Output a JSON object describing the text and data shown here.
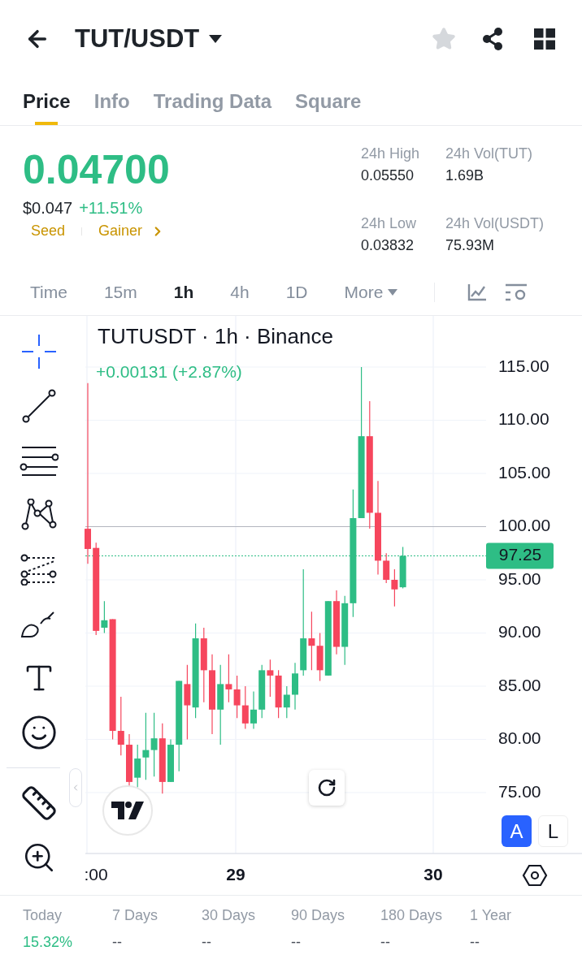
{
  "header": {
    "pair": "TUT/USDT",
    "favorite": false
  },
  "tabs": [
    {
      "label": "Price",
      "selected": true
    },
    {
      "label": "Info",
      "selected": false
    },
    {
      "label": "Trading Data",
      "selected": false
    },
    {
      "label": "Square",
      "selected": false
    }
  ],
  "price": {
    "last": "0.04700",
    "usd": "$0.047",
    "change": "+11.51%",
    "tags": [
      "Seed",
      "Gainer"
    ]
  },
  "stats": [
    {
      "label": "24h High",
      "value": "0.05550"
    },
    {
      "label": "24h Vol(TUT)",
      "value": "1.69B"
    },
    {
      "label": "24h Low",
      "value": "0.03832"
    },
    {
      "label": "24h Vol(USDT)",
      "value": "75.93M"
    }
  ],
  "intervals": [
    {
      "label": "Time",
      "selected": false,
      "kind": "plain"
    },
    {
      "label": "15m",
      "selected": false,
      "kind": "plain"
    },
    {
      "label": "1h",
      "selected": true,
      "kind": "plain"
    },
    {
      "label": "4h",
      "selected": false,
      "kind": "plain"
    },
    {
      "label": "1D",
      "selected": false,
      "kind": "plain"
    },
    {
      "label": "More",
      "selected": false,
      "kind": "dropdown"
    }
  ],
  "tools": {
    "drawing": [
      {
        "kind": "crosshair",
        "selected": true
      },
      {
        "kind": "trend-line",
        "selected": false
      },
      {
        "kind": "fib",
        "selected": false
      },
      {
        "kind": "pattern",
        "selected": false
      },
      {
        "kind": "prediction",
        "selected": false
      },
      {
        "kind": "brush",
        "selected": false
      },
      {
        "kind": "text",
        "selected": false
      },
      {
        "kind": "emoji",
        "selected": false
      }
    ],
    "measure": [
      {
        "kind": "ruler",
        "selected": false
      },
      {
        "kind": "zoom",
        "selected": false
      }
    ]
  },
  "chart": {
    "title": "TUTUSDT · 1h · Binance",
    "change": "+0.00131 (+2.87%)",
    "y_labels": [
      "115.00",
      "110.00",
      "105.00",
      "100.00",
      "95.00",
      "90.00",
      "85.00",
      "80.00",
      "75.00"
    ],
    "last_price": "97.25",
    "x_labels": [
      ":00",
      "29",
      "30"
    ],
    "scale_buttons": [
      {
        "label": "A",
        "selected": true
      },
      {
        "label": "L",
        "selected": false
      }
    ]
  },
  "performance": [
    {
      "label": "Today",
      "value": "15.32%",
      "kind": "positive"
    },
    {
      "label": "7 Days",
      "value": "--",
      "kind": "neutral"
    },
    {
      "label": "30 Days",
      "value": "--",
      "kind": "neutral"
    },
    {
      "label": "90 Days",
      "value": "--",
      "kind": "neutral"
    },
    {
      "label": "180 Days",
      "value": "--",
      "kind": "neutral"
    },
    {
      "label": "1 Year",
      "value": "--",
      "kind": "neutral"
    }
  ]
}
